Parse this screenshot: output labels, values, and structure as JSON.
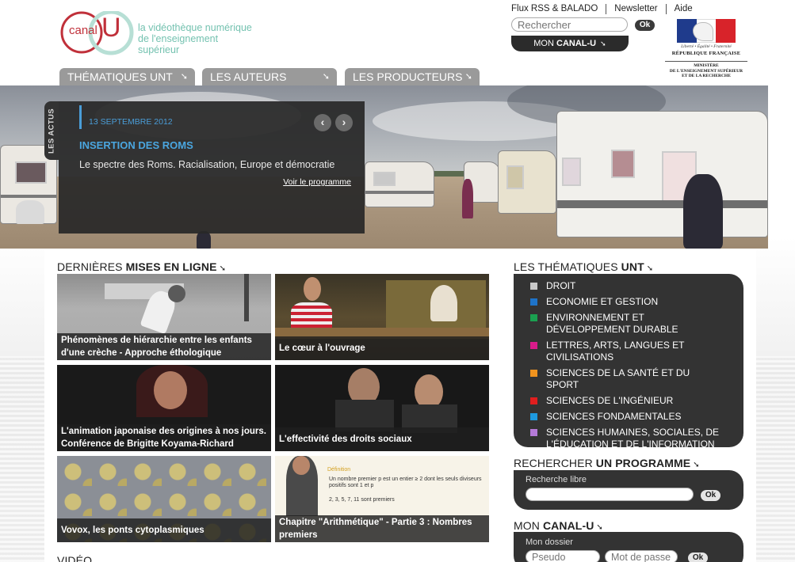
{
  "header": {
    "logo_word": "canal",
    "logo_letter": "U",
    "logo_tagline_1": "la vidéothèque numérique",
    "logo_tagline_2": "de l'enseignement supérieur",
    "links": [
      "Flux RSS & BALADO",
      "Newsletter",
      "Aide"
    ],
    "search_placeholder": "Rechercher",
    "ok_label": "Ok",
    "mon_prefix": "MON ",
    "mon_bold": "CANAL-U",
    "mon_arrow": "➘",
    "ministry_motto": "Liberté • Égalité • Fraternité",
    "ministry_republic": "RÉPUBLIQUE FRANÇAISE",
    "ministry_name_1": "MINISTÈRE",
    "ministry_name_2": "DE L'ENSEIGNEMENT SUPÉRIEUR",
    "ministry_name_3": "ET DE LA RECHERCHE"
  },
  "nav": {
    "tabs": [
      {
        "label": "THÉMATIQUES UNT",
        "arrow": "➘"
      },
      {
        "label": "LES AUTEURS",
        "arrow": "➘"
      },
      {
        "label": "LES PRODUCTEURS",
        "arrow": "➘"
      }
    ]
  },
  "actus": {
    "tab_label": "LES ACTUS",
    "date": "13 SEPTEMBRE 2012",
    "title": "INSERTION DES ROMS",
    "description": "Le spectre des Roms. Racialisation, Europe et démocratie",
    "link": "Voir le programme",
    "prev": "‹",
    "next": "›"
  },
  "latest": {
    "title_plain": "DERNIÈRES ",
    "title_bold": "MISES EN LIGNE",
    "arrow": "➘",
    "items": [
      {
        "caption": "Phénomènes de hiérarchie entre les enfants d'une crèche - Approche éthologique"
      },
      {
        "caption": "Le cœur à l'ouvrage"
      },
      {
        "caption": "L'animation japonaise des origines à nos jours. Conférence de Brigitte Koyama-Richard"
      },
      {
        "caption": "L'effectivité des droits sociaux"
      },
      {
        "caption": "Vovox, les ponts cytoplasmiques"
      },
      {
        "caption": "Chapitre \"Arithmétique\" - Partie 3 : Nombres premiers"
      }
    ],
    "slide_text_1": "Définition",
    "slide_text_2": "Un nombre premier p est un entier ≥ 2 dont les seuls diviseurs positifs sont 1 et p",
    "slide_text_3": "2, 3, 5, 7, 11 sont premiers"
  },
  "video_section": {
    "title": "VIDÉO"
  },
  "themes": {
    "title_plain": "LES THÉMATIQUES ",
    "title_bold": "UNT",
    "arrow": "➘",
    "items": [
      {
        "label": "DROIT",
        "color": "#c8c8c8"
      },
      {
        "label": "ECONOMIE ET GESTION",
        "color": "#1e73c8"
      },
      {
        "label": "ENVIRONNEMENT ET DÉVELOPPEMENT DURABLE",
        "color": "#1aa050"
      },
      {
        "label": "LETTRES, ARTS, LANGUES ET CIVILISATIONS",
        "color": "#d81b8a"
      },
      {
        "label": "SCIENCES DE LA SANTÉ ET DU SPORT",
        "color": "#f0931e"
      },
      {
        "label": "SCIENCES DE L'INGÉNIEUR",
        "color": "#e01e1e"
      },
      {
        "label": "SCIENCES FONDAMENTALES",
        "color": "#1e9ae0"
      },
      {
        "label": "SCIENCES HUMAINES, SOCIALES, DE L'ÉDUCATION ET DE L'INFORMATION",
        "color": "#b57ad8"
      }
    ]
  },
  "program_search": {
    "title_plain": "RECHERCHER ",
    "title_bold": "UN PROGRAMME",
    "arrow": "➘",
    "label": "Recherche libre",
    "ok_label": "Ok"
  },
  "moncanal": {
    "title_plain": "MON ",
    "title_bold": "CANAL-U",
    "arrow": "➘",
    "label": "Mon dossier",
    "username_placeholder": "Pseudo",
    "password_placeholder": "Mot de passe",
    "ok_label": "Ok"
  }
}
